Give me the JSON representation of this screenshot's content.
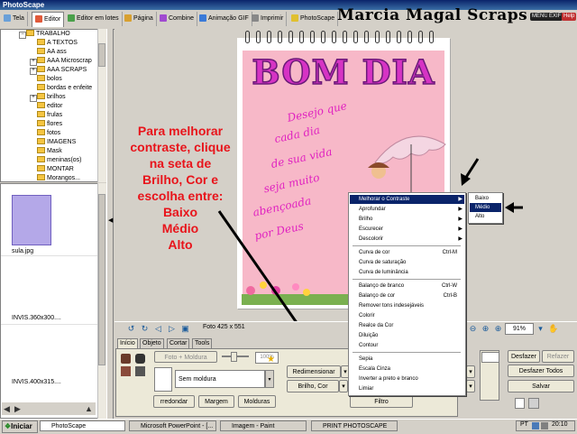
{
  "window": {
    "title": "PhotoScape"
  },
  "brand": {
    "text": "Marcia Magal Scraps"
  },
  "tabs": [
    {
      "label": "Tela"
    },
    {
      "label": "Editor"
    },
    {
      "label": "Editor em lotes"
    },
    {
      "label": "Página"
    },
    {
      "label": "Combine"
    },
    {
      "label": "Animação GIF"
    },
    {
      "label": "Imprimir"
    },
    {
      "label": "PhotoScape"
    }
  ],
  "title_buttons": {
    "menu": "MENU",
    "exif": "EXIF",
    "help": "Help"
  },
  "tree": {
    "items": [
      "TRABALHO",
      "A TEXTOS",
      "AA ass",
      "AAA Microscrap",
      "AAA SCRAPS",
      "bolos",
      "bordas e enfeite",
      "brilhos",
      "editor",
      "frulas",
      "flores",
      "fotos",
      "IMAGENS",
      "Mask",
      "meninas(os)",
      "MONTAR",
      "Morangos..."
    ]
  },
  "thumbnails": [
    {
      "caption": "sula.jpg"
    },
    {
      "caption": "INVIS.360x300...."
    },
    {
      "caption": "INVIS.400x315...."
    }
  ],
  "annotation": {
    "lines": [
      "Para melhorar",
      "contraste, clique",
      "na seta de",
      "Brilho, Cor e",
      "escolha entre:",
      "Baixo",
      "Médio",
      "Alto"
    ]
  },
  "photo": {
    "title": "BOM DIA",
    "message": [
      "Desejo que",
      "cada dia",
      "de sua vida",
      "seja muito",
      "abençoada",
      "por Deus"
    ]
  },
  "menu": {
    "items": [
      {
        "label": "Melhorar o Contraste",
        "shortcut": "",
        "submenu": true,
        "highlighted": true
      },
      {
        "label": "Aprofundar",
        "shortcut": "",
        "submenu": true
      },
      {
        "label": "Brilho",
        "shortcut": "",
        "submenu": true
      },
      {
        "label": "Escurecer",
        "shortcut": "",
        "submenu": true
      },
      {
        "label": "Descolorir",
        "shortcut": "",
        "submenu": true
      },
      {
        "sep": true
      },
      {
        "label": "Curva de cor",
        "shortcut": "Ctrl-M"
      },
      {
        "label": "Curva de saturação",
        "shortcut": ""
      },
      {
        "label": "Curva de luminância",
        "shortcut": ""
      },
      {
        "sep": true
      },
      {
        "label": "Balanço de branco",
        "shortcut": "Ctrl-W"
      },
      {
        "label": "Balanço de cor",
        "shortcut": "Ctrl-B"
      },
      {
        "label": "Remover tons indesejáveis",
        "shortcut": ""
      },
      {
        "label": "Colorir",
        "shortcut": ""
      },
      {
        "label": "Realce da Cor",
        "shortcut": ""
      },
      {
        "label": "Diluição",
        "shortcut": ""
      },
      {
        "label": "Contour",
        "shortcut": ""
      },
      {
        "sep": true
      },
      {
        "label": "Sepia",
        "shortcut": ""
      },
      {
        "label": "Escala Cinza",
        "shortcut": ""
      },
      {
        "label": "Inverter a preto e branco",
        "shortcut": ""
      },
      {
        "label": "Limiar",
        "shortcut": ""
      }
    ]
  },
  "submenu": {
    "items": [
      {
        "label": "Baixo"
      },
      {
        "label": "Médio",
        "highlighted": true
      },
      {
        "label": "Alto"
      }
    ]
  },
  "viewbar": {
    "photo_size": "Foto 425 x 551",
    "zoom": "91%"
  },
  "panel": {
    "tabs": [
      "Início",
      "Objeto",
      "Cortar",
      "Tools"
    ],
    "frame_label": "Foto + Moldura",
    "frame_value": "100%",
    "frame_name": "Sem moldura",
    "buttons": {
      "resize": "Redimensionar",
      "brightness": "Brilho, Cor",
      "filter": "Filtro",
      "arredondar": "rredondar",
      "margem": "Margem",
      "molduras": "Molduras",
      "undo": "Desfazer",
      "redo": "Refazer",
      "undo_all": "Desfazer Todos",
      "save": "Salvar"
    }
  },
  "taskbar": {
    "start": "Iniciar",
    "tasks": [
      "PhotoScape",
      "Microsoft PowerPoint - [...",
      "Imagem - Paint",
      "PRINT PHOTOSCAPE"
    ],
    "tray": "PT",
    "clock": "20:10"
  }
}
